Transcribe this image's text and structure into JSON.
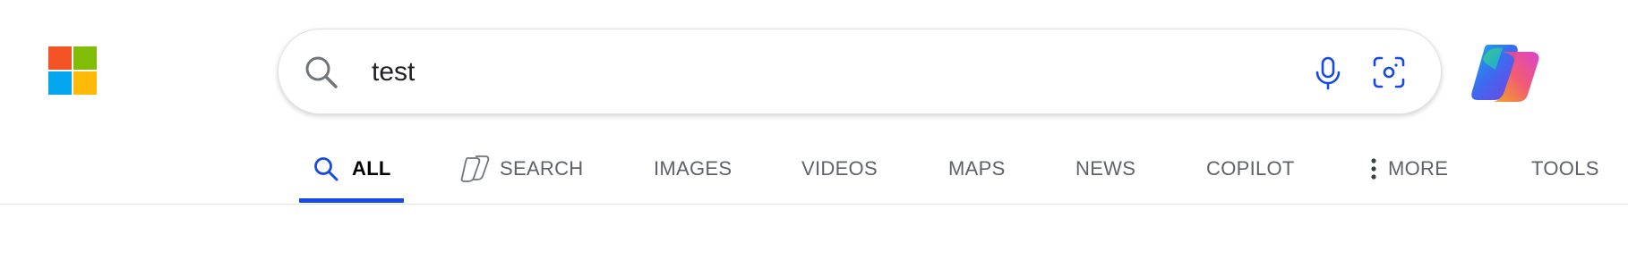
{
  "search": {
    "query": "test"
  },
  "icons": {
    "logo": "microsoft-logo",
    "search": "search-icon",
    "mic": "microphone-icon",
    "visual_search": "visual-search-icon",
    "copilot": "copilot-icon",
    "more": "more-dots-icon",
    "copilot_search": "copilot-search-icon"
  },
  "tabs": [
    {
      "label": "ALL",
      "active": true
    },
    {
      "label": "SEARCH",
      "active": false
    },
    {
      "label": "IMAGES",
      "active": false
    },
    {
      "label": "VIDEOS",
      "active": false
    },
    {
      "label": "MAPS",
      "active": false
    },
    {
      "label": "NEWS",
      "active": false
    },
    {
      "label": "COPILOT",
      "active": false
    },
    {
      "label": "MORE",
      "active": false
    },
    {
      "label": "TOOLS",
      "active": false
    }
  ],
  "colors": {
    "accent": "#174ae4",
    "logo_red": "#f35325",
    "logo_green": "#81bc06",
    "logo_blue": "#05a6f0",
    "logo_yellow": "#ffba08"
  }
}
